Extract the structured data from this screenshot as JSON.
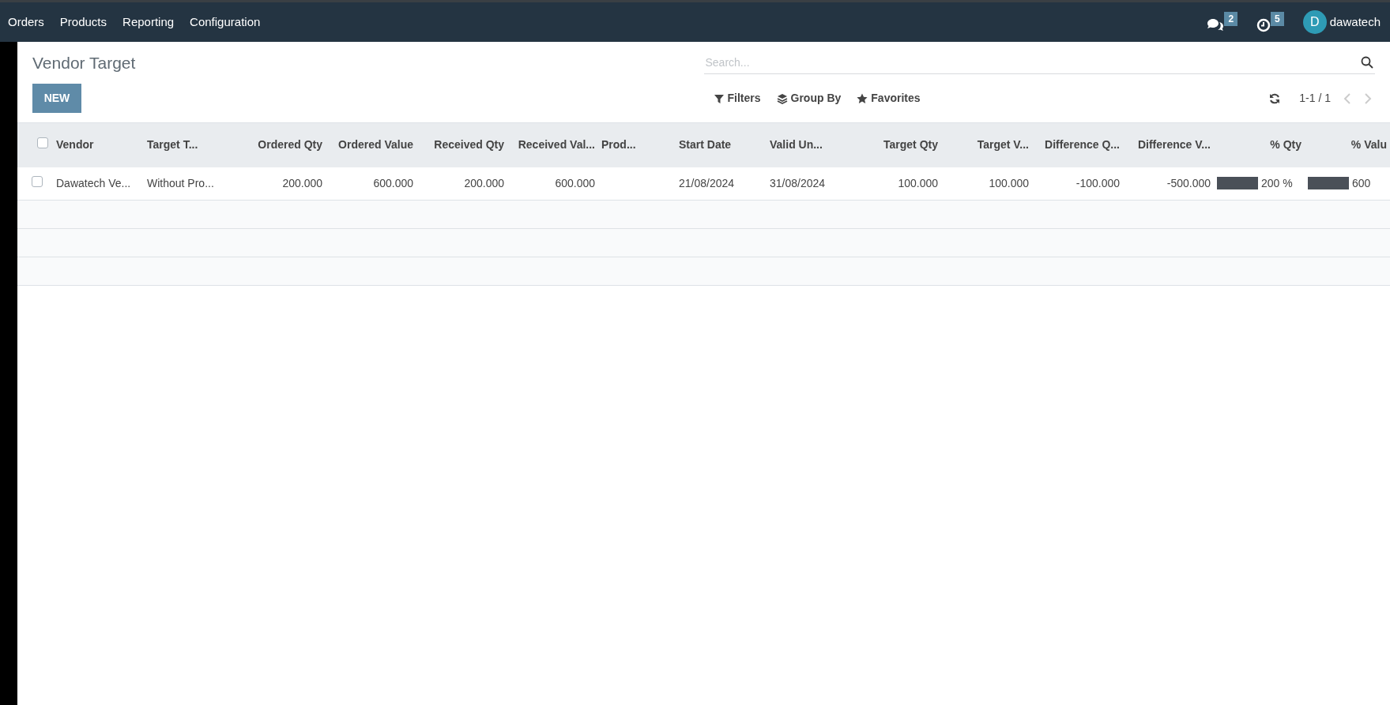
{
  "top_menu": [
    {
      "label": "Orders"
    },
    {
      "label": "Products"
    },
    {
      "label": "Reporting"
    },
    {
      "label": "Configuration"
    }
  ],
  "systray": {
    "messages_count": "2",
    "activities_count": "5",
    "user_initial": "D",
    "user_name": "dawatech"
  },
  "breadcrumb": "Vendor Target",
  "new_button": "NEW",
  "search": {
    "placeholder": "Search..."
  },
  "search_options": [
    {
      "kind": "filter",
      "label": "Filters"
    },
    {
      "kind": "group",
      "label": "Group By"
    },
    {
      "kind": "favorite",
      "label": "Favorites"
    }
  ],
  "pager": {
    "value": "1-1 / 1"
  },
  "table": {
    "select_all_checked": false,
    "columns": [
      {
        "label": "Vendor",
        "kind": "text"
      },
      {
        "label": "Target T...",
        "kind": "text"
      },
      {
        "label": "Ordered Qty",
        "kind": "number"
      },
      {
        "label": "Ordered Value",
        "kind": "number"
      },
      {
        "label": "Received Qty",
        "kind": "number"
      },
      {
        "label": "Received Val...",
        "kind": "number"
      },
      {
        "label": "Prod...",
        "kind": "text"
      },
      {
        "label": "Start Date",
        "kind": "text"
      },
      {
        "label": "Valid Un...",
        "kind": "text"
      },
      {
        "label": "Target Qty",
        "kind": "number"
      },
      {
        "label": "Target V...",
        "kind": "number"
      },
      {
        "label": "Difference Q...",
        "kind": "number"
      },
      {
        "label": "Difference V...",
        "kind": "number"
      },
      {
        "label": "% Qty",
        "kind": "number"
      },
      {
        "label": "% Valu",
        "kind": "number"
      }
    ],
    "rows": [
      {
        "checked": false,
        "cells": [
          {
            "kind": "text",
            "text": "Dawatech Ve..."
          },
          {
            "kind": "text",
            "text": "Without Pro..."
          },
          {
            "kind": "text",
            "text": "200.000"
          },
          {
            "kind": "text",
            "text": "600.000"
          },
          {
            "kind": "text",
            "text": "200.000"
          },
          {
            "kind": "text",
            "text": "600.000"
          },
          {
            "kind": "empty"
          },
          {
            "kind": "text",
            "text": "21/08/2024"
          },
          {
            "kind": "text",
            "text": "31/08/2024"
          },
          {
            "kind": "text",
            "text": "100.000"
          },
          {
            "kind": "text",
            "text": "100.000"
          },
          {
            "kind": "text",
            "text": "-100.000"
          },
          {
            "kind": "text",
            "text": "-500.000"
          },
          {
            "kind": "progress",
            "level": 1,
            "text": "200 %"
          },
          {
            "kind": "progress",
            "level": 1,
            "text": "600"
          }
        ]
      }
    ]
  }
}
